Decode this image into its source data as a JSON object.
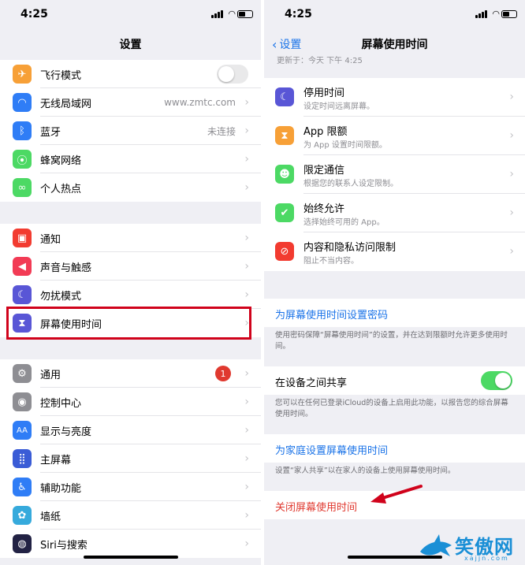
{
  "left": {
    "status_time": "4:25",
    "title": "设置",
    "group1": [
      {
        "label": "飞行模式",
        "icon": "airplane-icon",
        "color": "#f7a037",
        "glyph": "✈",
        "control": "toggle-off"
      },
      {
        "label": "无线局域网",
        "icon": "wifi-icon",
        "color": "#2f7df6",
        "glyph": "◠",
        "detail": "www.zmtc.com"
      },
      {
        "label": "蓝牙",
        "icon": "bluetooth-icon",
        "color": "#2f7df6",
        "glyph": "ᛒ",
        "detail": "未连接"
      },
      {
        "label": "蜂窝网络",
        "icon": "cellular-icon",
        "color": "#4cd964",
        "glyph": "⦿"
      },
      {
        "label": "个人热点",
        "icon": "hotspot-icon",
        "color": "#4cd964",
        "glyph": "∞"
      }
    ],
    "group2": [
      {
        "label": "通知",
        "icon": "notifications-icon",
        "color": "#f23b30",
        "glyph": "▣"
      },
      {
        "label": "声音与触感",
        "icon": "sound-icon",
        "color": "#f23b55",
        "glyph": "◀"
      },
      {
        "label": "勿扰模式",
        "icon": "moon-icon",
        "color": "#5956d6",
        "glyph": "☾"
      },
      {
        "label": "屏幕使用时间",
        "icon": "hourglass-icon",
        "color": "#5956d6",
        "glyph": "⧗"
      }
    ],
    "group3": [
      {
        "label": "通用",
        "icon": "gear-icon",
        "color": "#8e8e93",
        "glyph": "⚙",
        "badge": "1"
      },
      {
        "label": "控制中心",
        "icon": "control-center-icon",
        "color": "#8e8e93",
        "glyph": "◉"
      },
      {
        "label": "显示与亮度",
        "icon": "display-icon",
        "color": "#2f7df6",
        "glyph": "AA"
      },
      {
        "label": "主屏幕",
        "icon": "home-screen-icon",
        "color": "#3a5cd6",
        "glyph": "⣿"
      },
      {
        "label": "辅助功能",
        "icon": "accessibility-icon",
        "color": "#2f7df6",
        "glyph": "♿"
      },
      {
        "label": "墙纸",
        "icon": "wallpaper-icon",
        "color": "#36aadc",
        "glyph": "✿"
      },
      {
        "label": "Siri与搜索",
        "icon": "siri-icon",
        "color": "#222244",
        "glyph": "◍"
      }
    ]
  },
  "right": {
    "status_time": "4:25",
    "back_label": "设置",
    "title": "屏幕使用时间",
    "updated": "更新于：今天 下午 4:25",
    "items": [
      {
        "title": "停用时间",
        "sub": "设定时间远离屏幕。",
        "icon": "downtime-icon",
        "color": "#5956d6",
        "glyph": "☾"
      },
      {
        "title": "App 限额",
        "sub": "为 App 设置时间限额。",
        "icon": "app-limits-icon",
        "color": "#f7a037",
        "glyph": "⧗"
      },
      {
        "title": "限定通信",
        "sub": "根据您的联系人设定限制。",
        "icon": "communication-limits-icon",
        "color": "#4cd964",
        "glyph": "☻"
      },
      {
        "title": "始终允许",
        "sub": "选择始终可用的 App。",
        "icon": "always-allowed-icon",
        "color": "#4cd964",
        "glyph": "✔"
      },
      {
        "title": "内容和隐私访问限制",
        "sub": "阻止不当内容。",
        "icon": "restrictions-icon",
        "color": "#f23b30",
        "glyph": "⊘"
      }
    ],
    "passcode_link": "为屏幕使用时间设置密码",
    "passcode_note": "使用密码保障“屏幕使用时间”的设置，并在达到限额时允许更多使用时间。",
    "share_label": "在设备之间共享",
    "share_note": "您可以在任何已登录iCloud的设备上启用此功能，以报告您的综合屏幕使用时间。",
    "family_link": "为家庭设置屏幕使用时间",
    "family_note": "设置“家人共享”以在家人的设备上使用屏幕使用时间。",
    "turn_off": "关闭屏幕使用时间"
  },
  "watermark": {
    "text": "笑傲网",
    "sub": "xajjn.com"
  },
  "colors": {
    "link": "#1a73e8",
    "danger": "#e0392f",
    "highlight": "#d0021b",
    "toggle_on": "#4cd964"
  }
}
